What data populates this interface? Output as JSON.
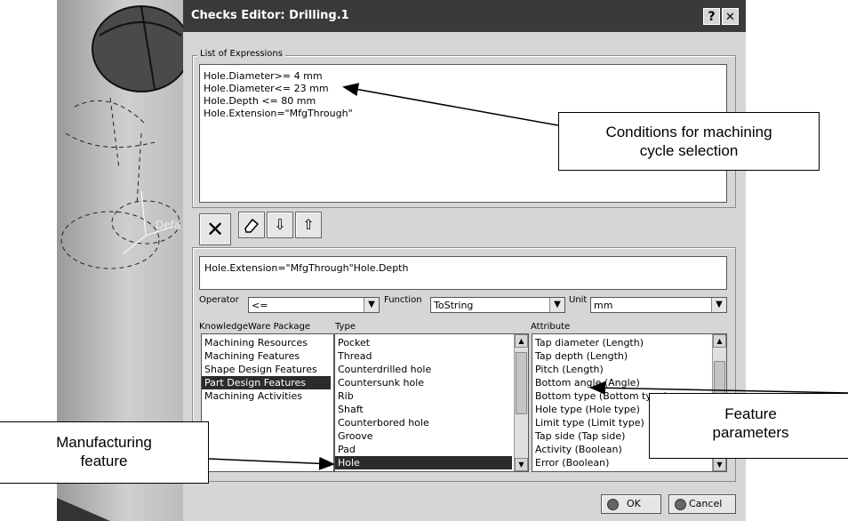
{
  "window": {
    "title": "Checks Editor: Drilling.1",
    "help_label": "?",
    "close_label": "✕"
  },
  "viewport": {
    "label": "Defa"
  },
  "expressions": {
    "group_label": "List of Expressions",
    "items": [
      "Hole.Diameter>= 4 mm",
      "Hole.Diameter<= 23 mm",
      "Hole.Depth  <= 80 mm",
      "Hole.Extension=\"MfgThrough\""
    ]
  },
  "toolbar": {
    "delete_icon": "✕",
    "erase_icon": "eraser",
    "down_icon": "⇩",
    "up_icon": "⇧"
  },
  "editor": {
    "value": "Hole.Extension=\"MfgThrough\"Hole.Depth",
    "operator_label": "Operator",
    "operator_value": "<=",
    "function_label": "Function",
    "function_value": "ToString",
    "unit_label": "Unit",
    "unit_value": "mm"
  },
  "packages": {
    "header": "KnowledgeWare Package",
    "items": [
      "Machining Resources",
      "Machining Features",
      "Shape Design Features",
      "Part Design Features",
      "Machining Activities"
    ],
    "selected": "Part Design Features"
  },
  "types": {
    "header": "Type",
    "items": [
      "Pocket",
      "Thread",
      "Counterdrilled hole",
      "Countersunk hole",
      "Rib",
      "Shaft",
      "Counterbored hole",
      "Groove",
      "Pad",
      "Hole"
    ],
    "selected": "Hole"
  },
  "attributes": {
    "header": "Attribute",
    "items": [
      "Tap diameter (Length)",
      "Tap depth (Length)",
      "Pitch (Length)",
      "Bottom angle (Angle)",
      "Bottom type (Bottom type)",
      "Hole type (Hole type)",
      "Limit type (Limit type)",
      "Tap side (Tap side)",
      "Activity (Boolean)",
      "Error (Boolean)"
    ]
  },
  "buttons": {
    "ok": "OK",
    "cancel": "Cancel"
  },
  "callouts": {
    "conditions": [
      "Conditions for machining",
      "cycle selection"
    ],
    "feature_params": [
      "Feature",
      "parameters"
    ],
    "manufacturing": [
      "Manufacturing",
      "feature"
    ]
  },
  "colors": {
    "titlebar": "#3a3a3a",
    "dialog": "#d6d6d6",
    "selection": "#2b2b2b"
  }
}
